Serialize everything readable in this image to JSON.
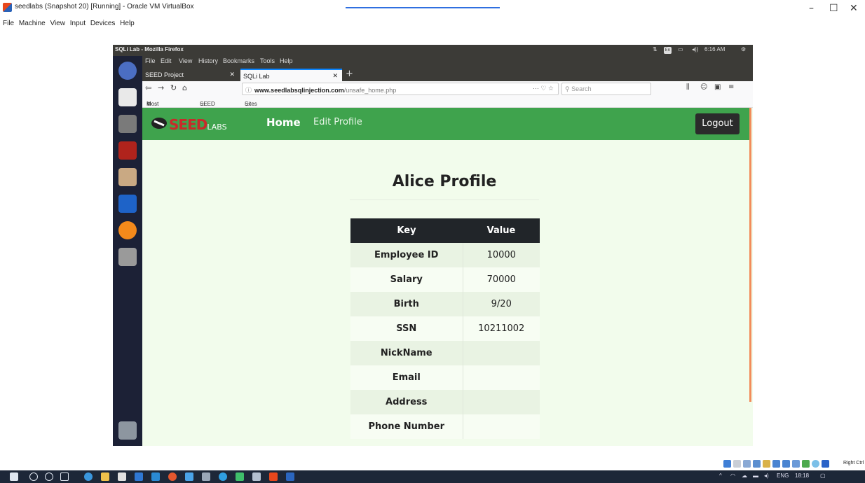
{
  "host_window": {
    "title": "seedlabs (Snapshot 20) [Running] - Oracle VM VirtualBox",
    "menu": [
      "File",
      "Machine",
      "View",
      "Input",
      "Devices",
      "Help"
    ],
    "controls": {
      "minimize": "–",
      "maximize": "☐",
      "close": "✕"
    }
  },
  "ubuntu_panel": {
    "window_title": "SQLi Lab - Mozilla Firefox",
    "keyboard": "En",
    "clock": "6:16 AM"
  },
  "firefox": {
    "menu": [
      "File",
      "Edit",
      "View",
      "History",
      "Bookmarks",
      "Tools",
      "Help"
    ],
    "tabs": [
      {
        "label": "SEED Project",
        "active": false
      },
      {
        "label": "SQLi Lab",
        "active": true
      }
    ],
    "new_tab": "+",
    "url_host": "www.seedlabsqlinjection.com",
    "url_path": "/unsafe_home.php",
    "search_placeholder": "Search",
    "bookmarks": [
      "Most Visited",
      "SEED Labs",
      "Sites for Labs"
    ]
  },
  "site": {
    "logo_main": "SEED",
    "logo_sub": "LABS",
    "nav_home": "Home",
    "nav_edit_profile": "Edit Profile",
    "logout": "Logout",
    "profile_title": "Alice Profile",
    "table_headers": {
      "key": "Key",
      "value": "Value"
    },
    "rows": [
      {
        "key": "Employee ID",
        "value": "10000"
      },
      {
        "key": "Salary",
        "value": "70000"
      },
      {
        "key": "Birth",
        "value": "9/20"
      },
      {
        "key": "SSN",
        "value": "10211002"
      },
      {
        "key": "NickName",
        "value": ""
      },
      {
        "key": "Email",
        "value": ""
      },
      {
        "key": "Address",
        "value": ""
      },
      {
        "key": "Phone Number",
        "value": ""
      }
    ]
  },
  "vbox_status": {
    "host_key": "Right Ctrl"
  },
  "taskbar": {
    "language": "ENG",
    "time": "18:18"
  },
  "colors": {
    "nav_green": "#3fa34d",
    "table_header": "#212529",
    "page_bg": "#f2fcec",
    "logo_red": "#c92a2a"
  }
}
